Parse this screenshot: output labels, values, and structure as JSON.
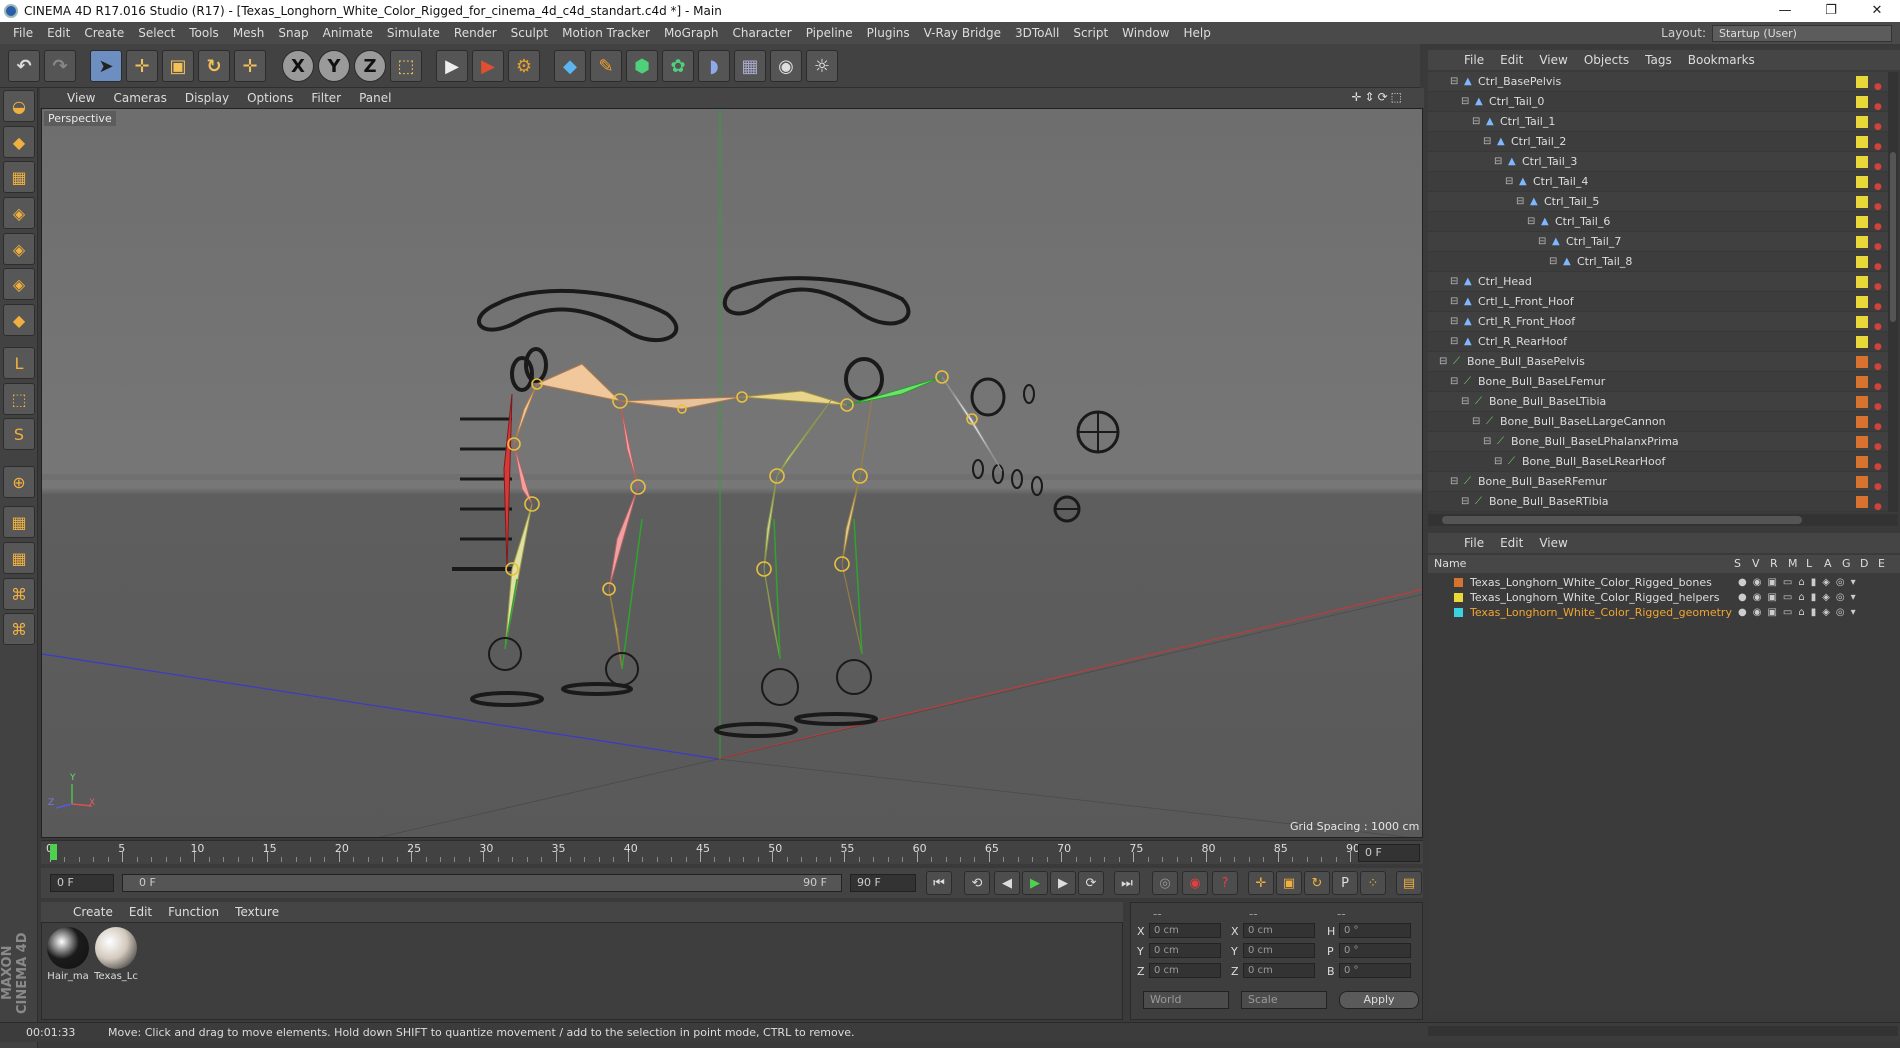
{
  "window": {
    "title": "CINEMA 4D R17.016 Studio (R17) - [Texas_Longhorn_White_Color_Rigged_for_cinema_4d_c4d_standart.c4d *] - Main",
    "minimize": "—",
    "restore": "❐",
    "close": "✕"
  },
  "menubar": {
    "items": [
      "File",
      "Edit",
      "Create",
      "Select",
      "Tools",
      "Mesh",
      "Snap",
      "Animate",
      "Simulate",
      "Render",
      "Sculpt",
      "Motion Tracker",
      "MoGraph",
      "Character",
      "Pipeline",
      "Plugins",
      "V-Ray Bridge",
      "3DToAll",
      "Script",
      "Window",
      "Help"
    ]
  },
  "layout": {
    "label": "Layout:",
    "value": "Startup (User)"
  },
  "toolbar": {
    "undo": "↶",
    "redo": "↷",
    "select": "➤",
    "move": "✛",
    "scale": "▣",
    "rotate": "↻",
    "transform": "✛",
    "x": "X",
    "y": "Y",
    "z": "Z",
    "coord": "⬚",
    "render_view": "▶",
    "render": "▶",
    "render_settings": "⚙",
    "cube": "◆",
    "pen": "✎",
    "subdiv": "⬢",
    "array": "✿",
    "deformer": "◗",
    "floor": "▦",
    "camera": "◉",
    "light": "☼"
  },
  "lefttools": [
    "◒",
    "◆",
    "▦",
    "◈",
    "◈",
    "◈",
    "◆",
    "L",
    "⬚",
    "S",
    "⊕",
    "▦",
    "▦",
    "⌘",
    "⌘"
  ],
  "viewport": {
    "menu": [
      "View",
      "Cameras",
      "Display",
      "Options",
      "Filter",
      "Panel"
    ],
    "icons": "✛⇕⟳⬚",
    "label": "Perspective",
    "grid_spacing": "Grid Spacing : 1000 cm",
    "axis_y": "Y",
    "axis_z": "Z",
    "axis_x": "X"
  },
  "timeline": {
    "ticks": [
      "0",
      "5",
      "10",
      "15",
      "20",
      "25",
      "30",
      "35",
      "40",
      "45",
      "50",
      "55",
      "60",
      "65",
      "70",
      "75",
      "80",
      "85",
      "90"
    ],
    "current_frame_field": "0 F",
    "start_field": "0 F",
    "range_start": "0 F",
    "range_end": "90 F",
    "end_field": "90 F"
  },
  "playback": {
    "first": "⏮",
    "prev_key": "⟲",
    "prev": "◀",
    "play": "▶",
    "next": "▶",
    "next_key": "⟳",
    "last": "⏭",
    "rec1": "◎",
    "rec2": "◉",
    "rec3": "?",
    "k_move": "✛",
    "k_scale": "▣",
    "k_rot": "↻",
    "k_param": "P",
    "k_pla": "⁘",
    "timeline_btn": "▤"
  },
  "materials": {
    "menu": [
      "Create",
      "Edit",
      "Function",
      "Texture"
    ],
    "items": [
      {
        "label": "Hair_ma",
        "color": "#1b1b1b"
      },
      {
        "label": "Texas_Lc",
        "color": "#d2c9bd"
      }
    ]
  },
  "coords": {
    "headers": [
      "--",
      "--",
      "--"
    ],
    "rows": [
      {
        "a": "X",
        "av": "0 cm",
        "b": "X",
        "bv": "0 cm",
        "c": "H",
        "cv": "0 °"
      },
      {
        "a": "Y",
        "av": "0 cm",
        "b": "Y",
        "bv": "0 cm",
        "c": "P",
        "cv": "0 °"
      },
      {
        "a": "Z",
        "av": "0 cm",
        "b": "Z",
        "bv": "0 cm",
        "c": "B",
        "cv": "0 °"
      }
    ],
    "world": "World",
    "scale": "Scale",
    "apply": "Apply"
  },
  "status": {
    "time": "00:01:33",
    "message": "Move: Click and drag to move elements. Hold down SHIFT to quantize movement / add to the selection in point mode, CTRL to remove."
  },
  "maxon": "MAXON CINEMA 4D",
  "objects": {
    "menu": [
      "File",
      "Edit",
      "View",
      "Objects",
      "Tags",
      "Bookmarks"
    ],
    "rows": [
      {
        "name": "Ctrl_BasePelvis",
        "indent": 2,
        "color": "#e8d83a",
        "type": "ctrl"
      },
      {
        "name": "Ctrl_Tail_0",
        "indent": 3,
        "color": "#e8d83a",
        "type": "ctrl"
      },
      {
        "name": "Ctrl_Tail_1",
        "indent": 4,
        "color": "#e8d83a",
        "type": "ctrl"
      },
      {
        "name": "Ctrl_Tail_2",
        "indent": 5,
        "color": "#e8d83a",
        "type": "ctrl"
      },
      {
        "name": "Ctrl_Tail_3",
        "indent": 6,
        "color": "#e8d83a",
        "type": "ctrl"
      },
      {
        "name": "Ctrl_Tail_4",
        "indent": 7,
        "color": "#e8d83a",
        "type": "ctrl"
      },
      {
        "name": "Ctrl_Tail_5",
        "indent": 8,
        "color": "#e8d83a",
        "type": "ctrl"
      },
      {
        "name": "Ctrl_Tail_6",
        "indent": 9,
        "color": "#e8d83a",
        "type": "ctrl"
      },
      {
        "name": "Ctrl_Tail_7",
        "indent": 10,
        "color": "#e8d83a",
        "type": "ctrl"
      },
      {
        "name": "Ctrl_Tail_8",
        "indent": 11,
        "color": "#e8d83a",
        "type": "ctrl"
      },
      {
        "name": "Ctrl_Head",
        "indent": 2,
        "color": "#e8d83a",
        "type": "ctrl"
      },
      {
        "name": "Crtl_L_Front_Hoof",
        "indent": 2,
        "color": "#e8d83a",
        "type": "ctrl"
      },
      {
        "name": "Crtl_R_Front_Hoof",
        "indent": 2,
        "color": "#e8d83a",
        "type": "ctrl"
      },
      {
        "name": "Ctrl_R_RearHoof",
        "indent": 2,
        "color": "#e8d83a",
        "type": "ctrl"
      },
      {
        "name": "Bone_Bull_BasePelvis",
        "indent": 1,
        "color": "#d8722f",
        "type": "bone"
      },
      {
        "name": "Bone_Bull_BaseLFemur",
        "indent": 2,
        "color": "#d8722f",
        "type": "bone"
      },
      {
        "name": "Bone_Bull_BaseLTibia",
        "indent": 3,
        "color": "#d8722f",
        "type": "bone"
      },
      {
        "name": "Bone_Bull_BaseLLargeCannon",
        "indent": 4,
        "color": "#d8722f",
        "type": "bone"
      },
      {
        "name": "Bone_Bull_BaseLPhalanxPrima",
        "indent": 5,
        "color": "#d8722f",
        "type": "bone"
      },
      {
        "name": "Bone_Bull_BaseLRearHoof",
        "indent": 6,
        "color": "#d8722f",
        "type": "bone"
      },
      {
        "name": "Bone_Bull_BaseRFemur",
        "indent": 2,
        "color": "#d8722f",
        "type": "bone"
      },
      {
        "name": "Bone_Bull_BaseRTibia",
        "indent": 3,
        "color": "#d8722f",
        "type": "bone"
      }
    ]
  },
  "layers": {
    "menu": [
      "File",
      "Edit",
      "View"
    ],
    "header": {
      "name": "Name",
      "flags": [
        "S",
        "V",
        "R",
        "M",
        "L",
        "A",
        "G",
        "D",
        "E"
      ]
    },
    "rows": [
      {
        "name": "Texas_Longhorn_White_Color_Rigged_bones",
        "color": "#d8722f",
        "text_color": "#dddddd"
      },
      {
        "name": "Texas_Longhorn_White_Color_Rigged_helpers",
        "color": "#e8d83a",
        "text_color": "#dddddd"
      },
      {
        "name": "Texas_Longhorn_White_Color_Rigged_geometry",
        "color": "#3ad3e0",
        "text_color": "#f2a531"
      }
    ]
  }
}
